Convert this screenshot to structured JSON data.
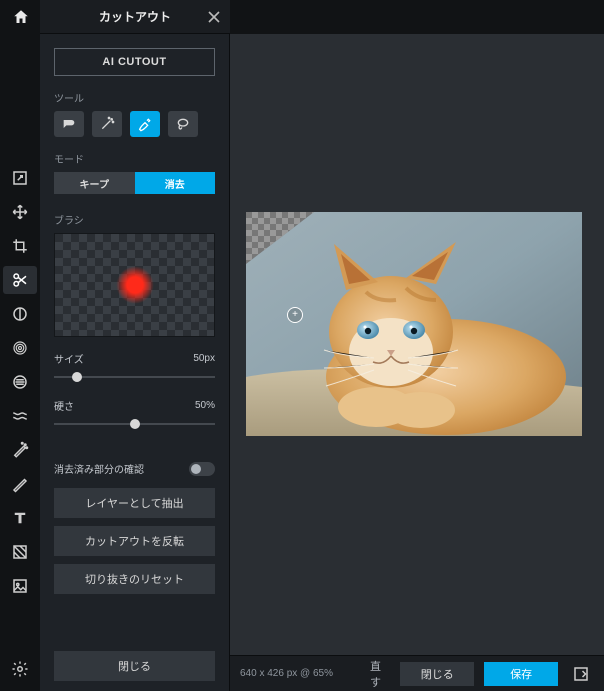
{
  "panel": {
    "title": "カットアウト",
    "ai_cutout": "AI CUTOUT",
    "section_tools": "ツール",
    "section_mode": "モード",
    "section_brush": "ブラシ",
    "mode_keep": "キープ",
    "mode_erase": "消去",
    "size_label": "サイズ",
    "size_value": "50px",
    "hardness_label": "硬さ",
    "hardness_value": "50%",
    "toggle_label": "消去済み部分の確認",
    "extract_layer": "レイヤーとして抽出",
    "invert_cutout": "カットアウトを反転",
    "reset_crop": "切り抜きのリセット",
    "close": "閉じる"
  },
  "status": {
    "dimensions": "640 x 426 px @ 65%"
  },
  "bottombar": {
    "redo_suffix": "直す",
    "close": "閉じる",
    "save": "保存"
  },
  "sliders": {
    "size_pct": 14,
    "hardness_pct": 50
  },
  "colors": {
    "accent": "#00a8e8",
    "brush": "#ff2a1a"
  }
}
